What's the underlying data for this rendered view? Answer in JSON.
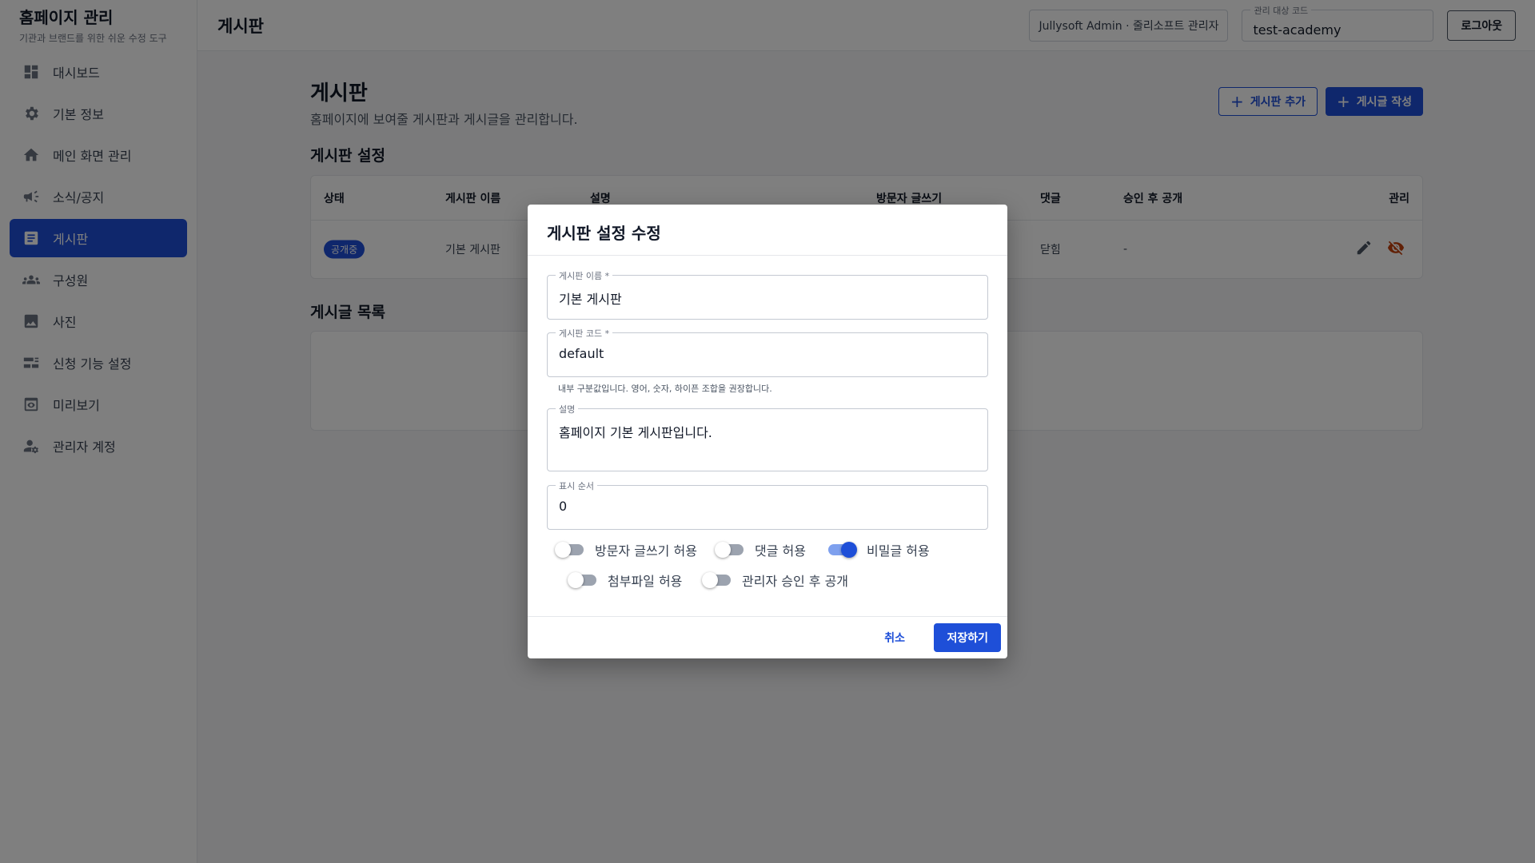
{
  "brand": {
    "title": "홈페이지 관리",
    "subtitle": "기관과 브랜드를 위한 쉬운 수정 도구"
  },
  "sidebar": {
    "items": [
      {
        "label": "대시보드",
        "icon": "dashboard-icon"
      },
      {
        "label": "기본 정보",
        "icon": "gear-icon"
      },
      {
        "label": "메인 화면 관리",
        "icon": "home-icon"
      },
      {
        "label": "소식/공지",
        "icon": "megaphone-icon"
      },
      {
        "label": "게시판",
        "icon": "article-icon",
        "active": true
      },
      {
        "label": "구성원",
        "icon": "people-icon"
      },
      {
        "label": "사진",
        "icon": "image-icon"
      },
      {
        "label": "신청 기능 설정",
        "icon": "form-icon"
      },
      {
        "label": "미리보기",
        "icon": "preview-icon"
      },
      {
        "label": "관리자 계정",
        "icon": "admin-icon"
      }
    ]
  },
  "topbar": {
    "title": "게시판",
    "admin_chip": "Jullysoft Admin · 줄리소프트 관리자",
    "code_label": "관리 대상 코드",
    "code_value": "test-academy",
    "logout": "로그아웃"
  },
  "page": {
    "title": "게시판",
    "description": "홈페이지에 보여줄 게시판과 게시글을 관리합니다.",
    "add_board": "게시판 추가",
    "write_post": "게시글 작성",
    "board_settings_title": "게시판 설정",
    "post_list_title": "게시글 목록",
    "table": {
      "headers": [
        "상태",
        "게시판 이름",
        "설명",
        "방문자 글쓰기",
        "댓글",
        "승인 후 공개",
        "관리"
      ],
      "rows": [
        {
          "status": "공개중",
          "name": "기본 게시판",
          "comments": "닫힘",
          "approval": "-"
        }
      ]
    }
  },
  "dialog": {
    "title": "게시판 설정 수정",
    "name_label": "게시판 이름 *",
    "name_value": "기본 게시판",
    "code_label": "게시판 코드 *",
    "code_value": "default",
    "code_helper": "내부 구분값입니다. 영어, 숫자, 하이픈 조합을 권장합니다.",
    "desc_label": "설명",
    "desc_value": "홈페이지 기본 게시판입니다.",
    "order_label": "표시 순서",
    "order_value": "0",
    "toggles": [
      {
        "label": "방문자 글쓰기 허용",
        "on": false
      },
      {
        "label": "댓글 허용",
        "on": false
      },
      {
        "label": "비밀글 허용",
        "on": true
      },
      {
        "label": "첨부파일 허용",
        "on": false
      },
      {
        "label": "관리자 승인 후 공개",
        "on": false
      }
    ],
    "cancel": "취소",
    "save": "저장하기"
  },
  "colors": {
    "primary": "#1e4fd8",
    "overlay": "rgba(0,0,0,0.5)",
    "hide_icon": "#c2410c"
  }
}
